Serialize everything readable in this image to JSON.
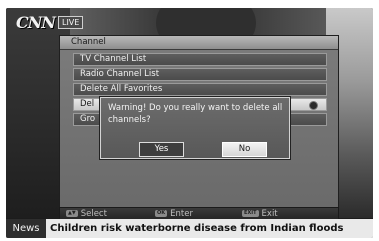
{
  "logo": {
    "brand": "CNN",
    "badge": "LIVE"
  },
  "menu": {
    "title": "Channel",
    "items": [
      {
        "label": "TV Channel List"
      },
      {
        "label": "Radio Channel List"
      },
      {
        "label": "Delete All Favorites"
      },
      {
        "label": "Del"
      },
      {
        "label": "Gro"
      }
    ]
  },
  "dialog": {
    "message": "Warning! Do you really want to delete all channels?",
    "yes_label": "Yes",
    "no_label": "No",
    "focused": "No"
  },
  "hints": {
    "select_key": "▲▼",
    "select_label": "Select",
    "enter_key": "OK",
    "enter_label": "Enter",
    "exit_key": "EXIT",
    "exit_label": "Exit"
  },
  "ticker": {
    "tag": "News",
    "headline": "Children risk waterborne disease from Indian floods"
  }
}
